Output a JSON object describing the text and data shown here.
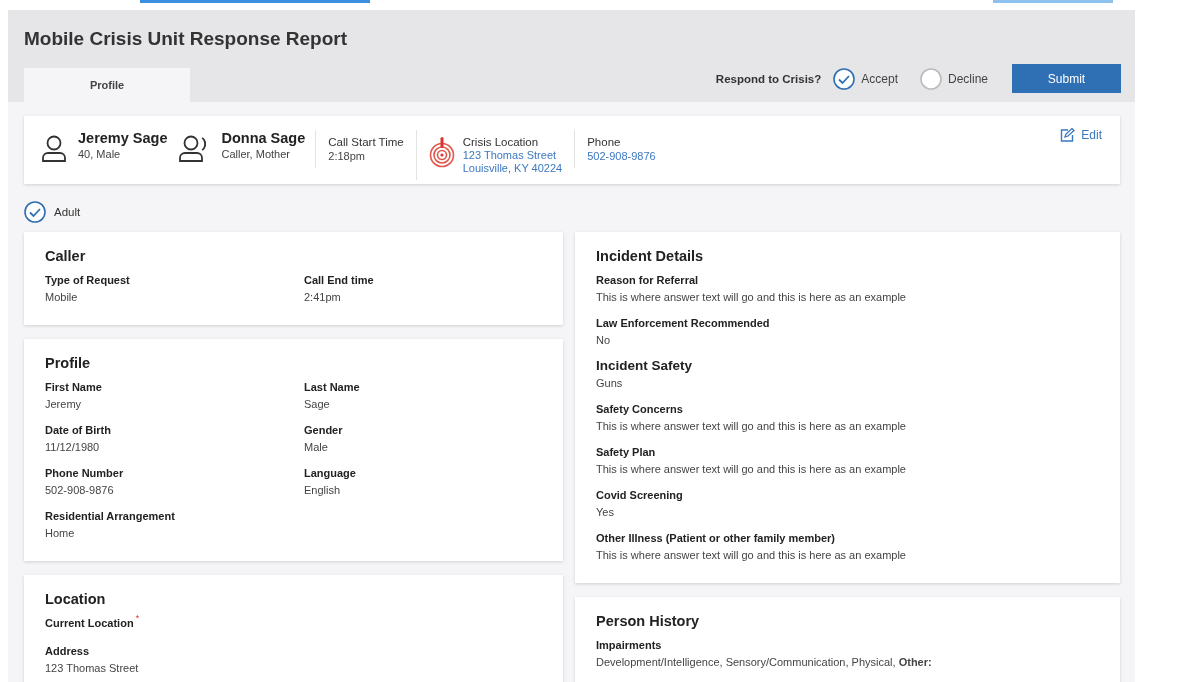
{
  "header": {
    "title": "Mobile Crisis Unit Response Report",
    "tabs": [
      {
        "label": "Profile",
        "selected": true
      }
    ],
    "respond": {
      "label": "Respond to Crisis?",
      "options": [
        {
          "label": "Accept",
          "selected": true
        },
        {
          "label": "Decline",
          "selected": false
        }
      ],
      "submit": "Submit"
    }
  },
  "summary": {
    "people": [
      {
        "kind": "person",
        "name": "Jeremy Sage",
        "detail": "40, Male"
      },
      {
        "kind": "caller",
        "name": "Donna Sage",
        "detail": "Caller, Mother"
      }
    ],
    "call_start": {
      "label": "Call Start Time",
      "value": "2:18pm"
    },
    "location": {
      "label": "Crisis Location",
      "lines": [
        "123 Thomas Street",
        "Louisville, KY 40224"
      ]
    },
    "phone": {
      "label": "Phone",
      "value": "502-908-9876"
    },
    "edit": "Edit"
  },
  "adult": {
    "label": "Adult",
    "checked": true
  },
  "left_cards": [
    {
      "title": "Caller",
      "kind": "two-column",
      "fields": [
        {
          "kind": "field",
          "label": "Type of Request",
          "value": "Mobile"
        },
        {
          "kind": "field",
          "label": "Call End time",
          "value": "2:41pm"
        }
      ]
    },
    {
      "title": "Profile",
      "kind": "two-column",
      "fields": [
        {
          "kind": "field",
          "label": "First Name",
          "value": "Jeremy"
        },
        {
          "kind": "field",
          "label": "Last Name",
          "value": "Sage"
        },
        {
          "kind": "field",
          "label": "Date of Birth",
          "value": "11/12/1980"
        },
        {
          "kind": "field",
          "label": "Gender",
          "value": "Male"
        },
        {
          "kind": "field",
          "label": "Phone Number",
          "value": "502-908-9876"
        },
        {
          "kind": "field",
          "label": "Language",
          "value": "English"
        },
        {
          "kind": "field",
          "label": "Residential Arrangement",
          "value": "Home"
        }
      ]
    },
    {
      "title": "Location",
      "kind": "single",
      "fields": [
        {
          "kind": "field",
          "label": "Current Location",
          "marker": "*"
        },
        {
          "kind": "field",
          "label": "Address",
          "value": "123 Thomas Street"
        }
      ]
    }
  ],
  "right_cards": [
    {
      "title": "Incident Details",
      "kind": "single",
      "fields": [
        {
          "kind": "field",
          "label": "Reason for Referral",
          "value": "This is where answer text will go and this is here as an example"
        },
        {
          "kind": "field",
          "label": "Law Enforcement Recommended",
          "value": "No"
        },
        {
          "kind": "subheading",
          "label": "Incident Safety",
          "value": "Guns"
        },
        {
          "kind": "field",
          "label": "Safety Concerns",
          "value": "This is where answer text will go and this is here as an example"
        },
        {
          "kind": "field",
          "label": "Safety Plan",
          "value": "This is where answer text will go and this is here as an example"
        },
        {
          "kind": "field",
          "label": "Covid Screening",
          "value": "Yes"
        },
        {
          "kind": "field",
          "label": "Other Illness (Patient or other family member)",
          "value": "This is where answer text will go and this is here as an example"
        }
      ]
    },
    {
      "title": "Person History",
      "kind": "single",
      "fields": [
        {
          "kind": "field",
          "label": "Impairments",
          "value": "Development/Intelligence, Sensory/Communication, Physical, **Other:**"
        }
      ]
    }
  ]
}
